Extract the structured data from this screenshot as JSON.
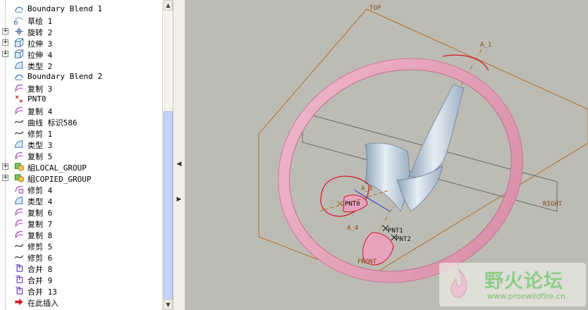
{
  "model_tree": {
    "items": [
      {
        "label": "Boundary Blend 1",
        "icon": "boundary-blend-icon",
        "expandable": false
      },
      {
        "label": "草绘 1",
        "icon": "sketch-icon",
        "expandable": false
      },
      {
        "label": "旋转 2",
        "icon": "revolve-icon",
        "expandable": true
      },
      {
        "label": "拉伸 3",
        "icon": "extrude-icon",
        "expandable": true
      },
      {
        "label": "拉伸 4",
        "icon": "extrude-icon",
        "expandable": true
      },
      {
        "label": "类型 2",
        "icon": "style-icon",
        "expandable": false
      },
      {
        "label": "Boundary Blend 2",
        "icon": "boundary-blend-icon",
        "expandable": false
      },
      {
        "label": "复制 3",
        "icon": "copy-icon",
        "expandable": false
      },
      {
        "label": "PNT0",
        "icon": "datum-point-icon",
        "expandable": false
      },
      {
        "label": "复制 4",
        "icon": "copy-icon",
        "expandable": false
      },
      {
        "label": "曲线 标识586",
        "icon": "curve-icon",
        "expandable": false
      },
      {
        "label": "修剪 1",
        "icon": "curve-icon",
        "expandable": false
      },
      {
        "label": "类型 3",
        "icon": "style-icon",
        "expandable": false
      },
      {
        "label": "复制 5",
        "icon": "copy-icon",
        "expandable": false
      },
      {
        "label": "組LOCAL_GROUP",
        "icon": "group-icon",
        "expandable": true
      },
      {
        "label": "組COPIED_GROUP",
        "icon": "group-icon",
        "expandable": true
      },
      {
        "label": "修剪 4",
        "icon": "trim-icon",
        "expandable": false
      },
      {
        "label": "类型 4",
        "icon": "style-icon",
        "expandable": false
      },
      {
        "label": "复制 6",
        "icon": "copy-icon",
        "expandable": false
      },
      {
        "label": "复制 7",
        "icon": "copy-icon",
        "expandable": false
      },
      {
        "label": "复制 8",
        "icon": "copy-icon",
        "expandable": false
      },
      {
        "label": "修剪 5",
        "icon": "curve-icon",
        "expandable": false
      },
      {
        "label": "修剪 6",
        "icon": "curve-icon",
        "expandable": false
      },
      {
        "label": "合并 8",
        "icon": "merge-icon",
        "expandable": false
      },
      {
        "label": "合并 9",
        "icon": "merge-icon",
        "expandable": false
      },
      {
        "label": "合并 13",
        "icon": "merge-icon",
        "expandable": false
      },
      {
        "label": "在此插入",
        "icon": "insert-here-arrow-icon",
        "expandable": false
      }
    ],
    "expand_symbol": "+"
  },
  "viewport": {
    "datum_labels": {
      "top": "TOP",
      "right": "RIGHT",
      "front": "FRONT",
      "axis_a1": "A_1",
      "axis_a3": "A_3",
      "axis_a4": "A_4"
    },
    "point_labels": {
      "pnt0": "PNT0",
      "pnt1": "PNT1",
      "pnt2": "PNT2"
    }
  },
  "watermark": {
    "name": "野火论坛",
    "url": "www.proewildfire.cn"
  },
  "colors": {
    "background": "#bdbcb4",
    "rim": "#e8a3bc",
    "spoke": "#b7c8d8",
    "datum": "#b06d2c",
    "highlight": "#d4142a",
    "scroll_thumb": "#c6d3f7"
  },
  "ui": {
    "scroll_up": "▲",
    "scroll_down": "▼",
    "collapse_left": "◀",
    "collapse_right": "▶"
  }
}
